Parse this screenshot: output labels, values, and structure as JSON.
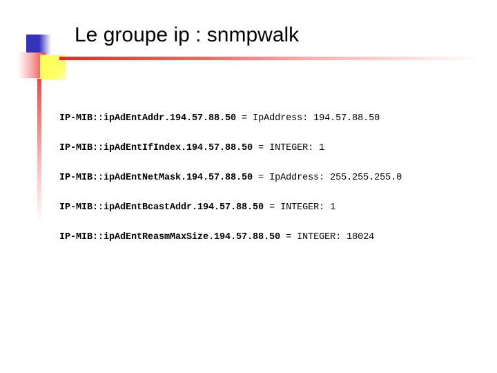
{
  "slide": {
    "title": "Le groupe ip : snmpwalk",
    "decoration": {
      "blue_color": "#3333BB",
      "yellow_color": "#FFFF55",
      "red_color": "#E84B4B"
    },
    "entries": [
      {
        "oid": "IP-MIB::ipAdEntAddr.194.57.88.50",
        "separator": " = ",
        "value": "IpAddress: 194.57.88.50",
        "type": "IpAddress"
      },
      {
        "oid": "IP-MIB::ipAdEntIfIndex.194.57.88.50",
        "separator": " = ",
        "value": "INTEGER: 1",
        "type": "INTEGER"
      },
      {
        "oid": "IP-MIB::ipAdEntNetMask.194.57.88.50",
        "separator": " = ",
        "value": "IpAddress: 255.255.255.0",
        "type": "IpAddress"
      },
      {
        "oid": "IP-MIB::ipAdEntBcastAddr.194.57.88.50",
        "separator": " = ",
        "value": "INTEGER: 1",
        "type": "INTEGER"
      },
      {
        "oid": "IP-MIB::ipAdEntReasmMaxSize.194.57.88.50",
        "separator": " = ",
        "value": "INTEGER: 18024",
        "type": "INTEGER"
      }
    ]
  }
}
